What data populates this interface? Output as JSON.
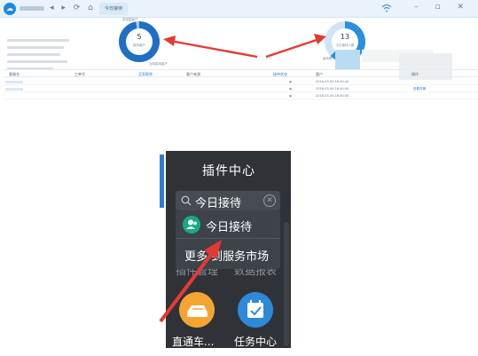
{
  "top_screenshot": {
    "window_tab": "今日接待",
    "left_donut": {
      "value": "5",
      "sub_label": "接待客户",
      "top_label": "未回复客户",
      "bottom_label": "当前接待客户"
    },
    "right_donut": {
      "value": "13",
      "sub_label": "今日接待人数",
      "top_label": "进行接待人数",
      "bottom_label": "接待率"
    },
    "table": {
      "headers": [
        "客服名",
        "工单号",
        "买家昵称",
        "客户来源",
        "接待状态",
        "客户",
        "操作"
      ],
      "rows": [
        {
          "time": "2016-03-04 16:40:45",
          "op": ""
        },
        {
          "time": "2016-03-04 16:40:45",
          "op": "查看详情"
        },
        {
          "time": "2016-03-04 16:40:45",
          "op": ""
        }
      ]
    }
  },
  "plugin_center": {
    "title": "插件中心",
    "search": {
      "value": "今日接待"
    },
    "dropdown": {
      "result_label": "今日接待",
      "more_link": "更多 到服务市场"
    },
    "behind_labels": [
      "插件管理",
      "数据报表"
    ],
    "apps": [
      {
        "label": "直通车..."
      },
      {
        "label": "任务中心"
      }
    ]
  },
  "colors": {
    "accent_blue": "#1f6fc5",
    "annotation_red": "#e53935",
    "panel_dark": "#2f3338",
    "avatar_green": "#19a984"
  }
}
